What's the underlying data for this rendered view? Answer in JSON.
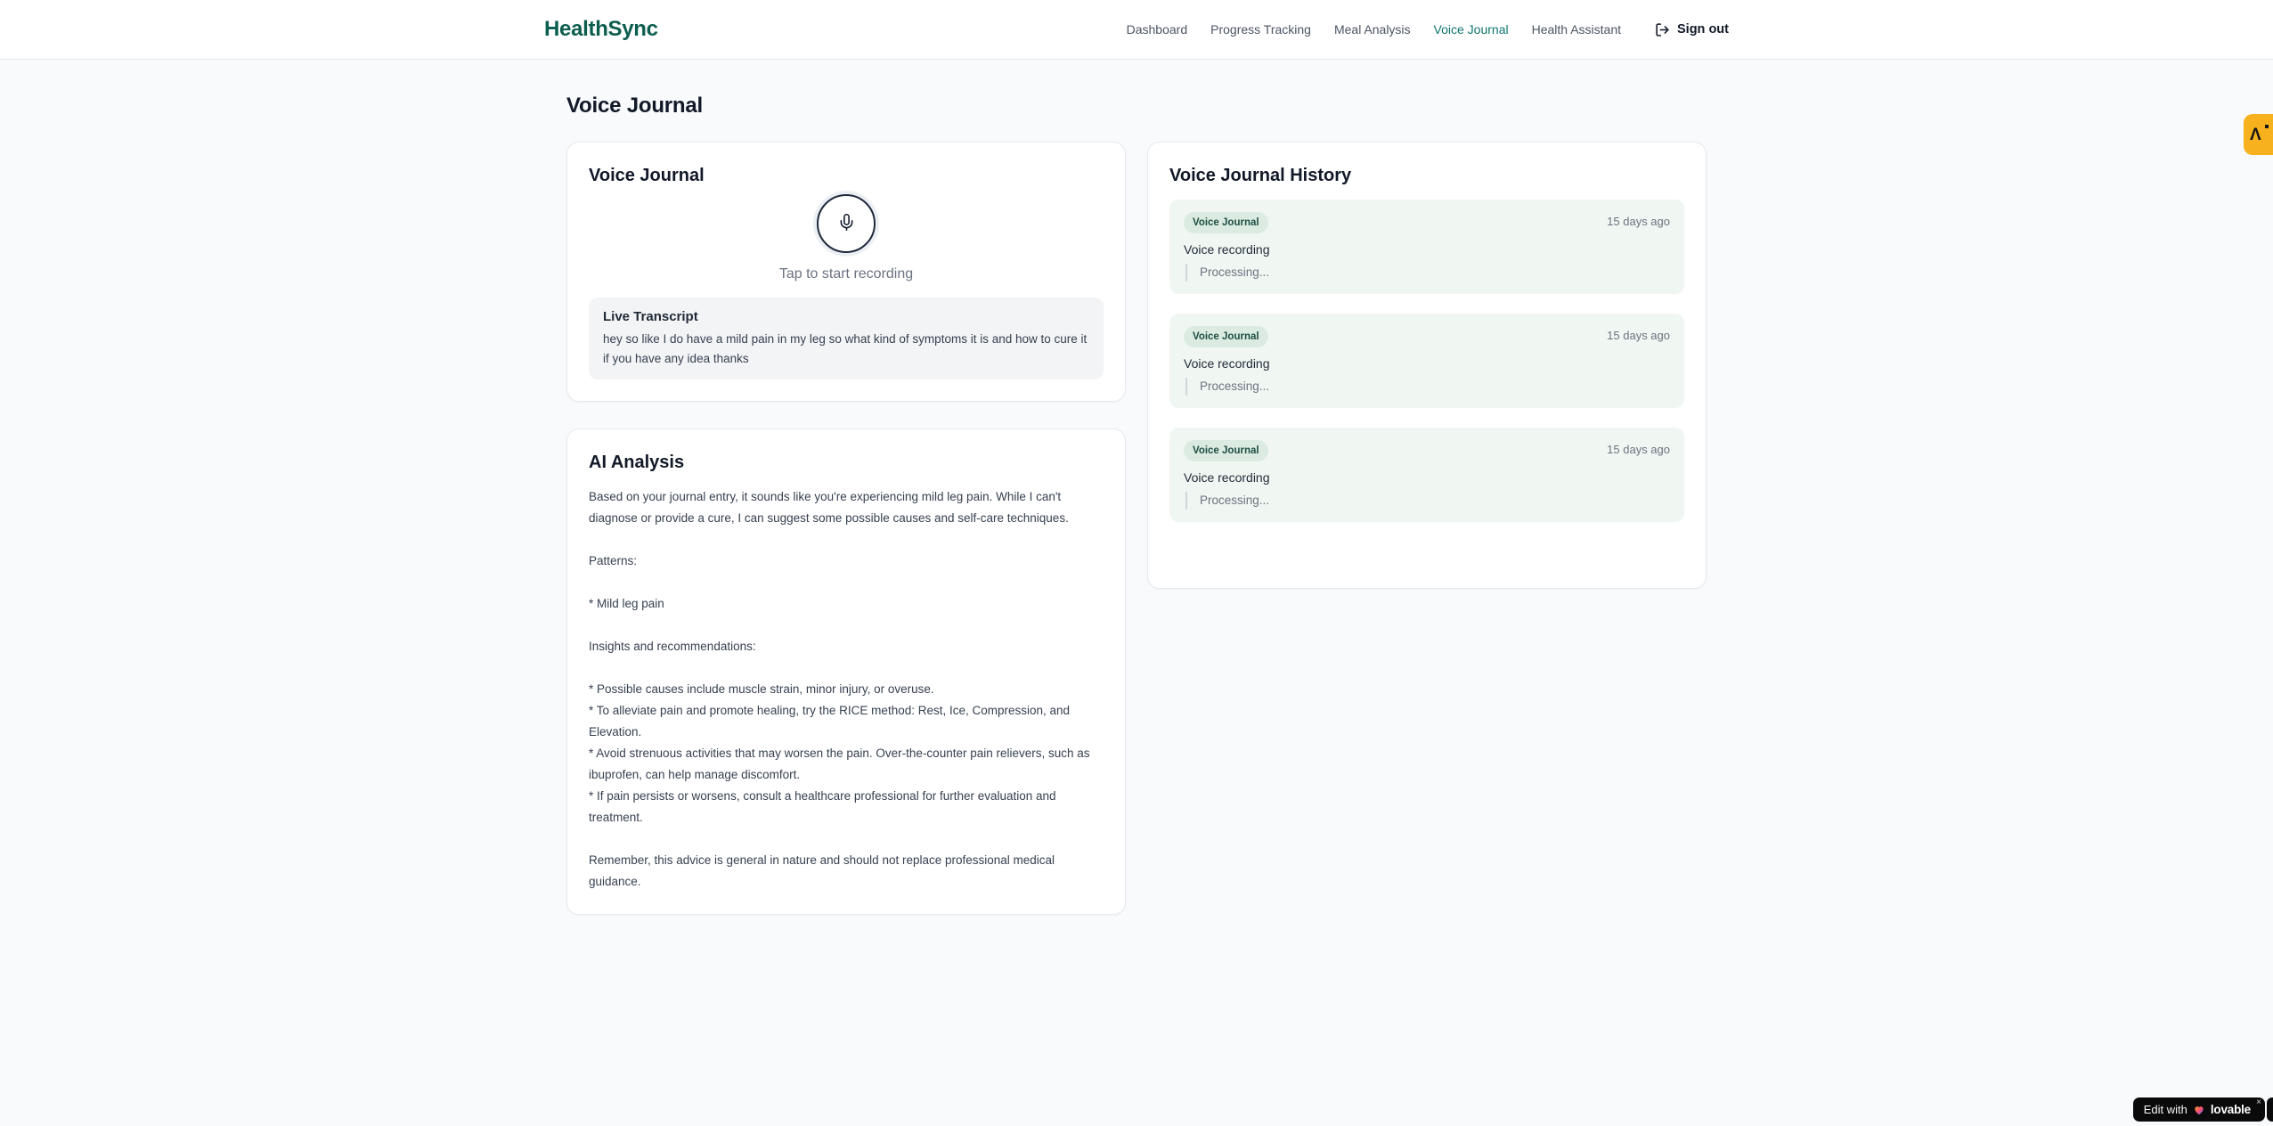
{
  "brand": {
    "name": "HealthSync"
  },
  "nav": {
    "items": [
      "Dashboard",
      "Progress Tracking",
      "Meal Analysis",
      "Voice Journal",
      "Health Assistant"
    ],
    "active_item": "Voice Journal",
    "sign_out_label": "Sign out",
    "sign_out_icon": "log-out-icon"
  },
  "page": {
    "title": "Voice Journal"
  },
  "recorder": {
    "card_title": "Voice Journal",
    "mic_icon": "mic-icon",
    "caption": "Tap to start recording",
    "transcript_label": "Live Transcript",
    "transcript_text": "hey so like I do have a mild pain in my leg so what kind of symptoms it is and how to cure it if you have any idea thanks"
  },
  "analysis": {
    "card_title": "AI Analysis",
    "body": "Based on your journal entry, it sounds like you're experiencing mild leg pain. While I can't diagnose or provide a cure, I can suggest some possible causes and self-care techniques.\n\nPatterns:\n\n* Mild leg pain\n\nInsights and recommendations:\n\n* Possible causes include muscle strain, minor injury, or overuse.\n* To alleviate pain and promote healing, try the RICE method: Rest, Ice, Compression, and Elevation.\n* Avoid strenuous activities that may worsen the pain. Over-the-counter pain relievers, such as ibuprofen, can help manage discomfort.\n* If pain persists or worsens, consult a healthcare professional for further evaluation and treatment.\n\nRemember, this advice is general in nature and should not replace professional medical guidance."
  },
  "history": {
    "card_title": "Voice Journal History",
    "entries": [
      {
        "badge": "Voice Journal",
        "time": "15 days ago",
        "label": "Voice recording",
        "status": "Processing..."
      },
      {
        "badge": "Voice Journal",
        "time": "15 days ago",
        "label": "Voice recording",
        "status": "Processing..."
      },
      {
        "badge": "Voice Journal",
        "time": "15 days ago",
        "label": "Voice recording",
        "status": "Processing..."
      }
    ]
  },
  "floating": {
    "edge_tab": {
      "icon": "amber-logo-icon",
      "glyph": "Λ"
    },
    "lovable_badge": {
      "prefix": "Edit with",
      "brand": "lovable",
      "heart_icon": "heart-icon",
      "close_icon": "close-icon",
      "close_glyph": "×"
    }
  },
  "colors": {
    "brand_teal": "#0b5d4e",
    "nav_active_teal": "#0f766e",
    "history_entry_bg": "#f0f7f2",
    "badge_bg": "#dcebe1",
    "badge_text": "#1d4e44",
    "edge_tab_amber": "#f6b11c",
    "lovable_badge_bg": "#0a0a0a",
    "page_bg": "#f8fafc"
  }
}
